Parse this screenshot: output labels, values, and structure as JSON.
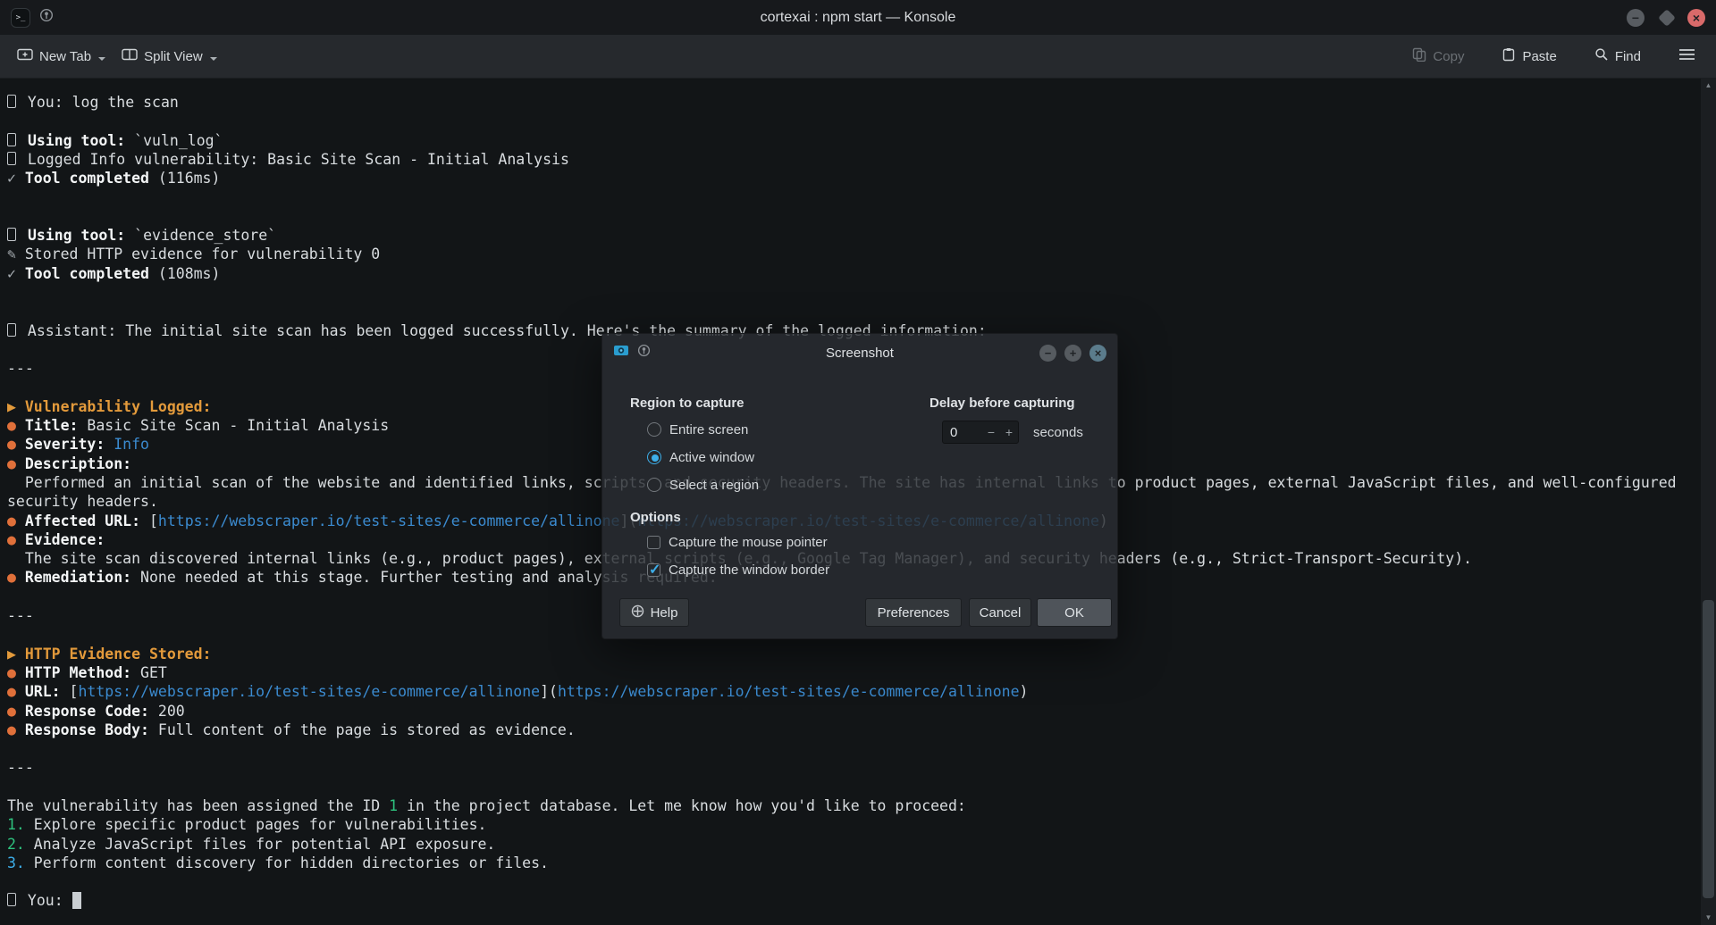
{
  "window": {
    "title": "cortexai : npm start — Konsole"
  },
  "glyphs": {
    "minimize": "−",
    "close": "×",
    "minus": "−",
    "plus": "+",
    "scroll_up": "▲",
    "scroll_down": "▼",
    "check": "✓",
    "app_icon_text": ">_"
  },
  "toolbar": {
    "new_tab_label": "New Tab",
    "split_view_label": "Split View",
    "copy_label": "Copy",
    "paste_label": "Paste",
    "find_label": "Find"
  },
  "terminal": {
    "lines": [
      [
        {
          "c": "box"
        },
        {
          "t": " You: log the scan"
        }
      ],
      [],
      [
        {
          "c": "box"
        },
        {
          "t": " "
        },
        {
          "t": "Using tool:",
          "c": "b"
        },
        {
          "t": " `vuln_log`"
        }
      ],
      [
        {
          "c": "box"
        },
        {
          "t": " Logged Info vulnerability: Basic Site Scan - Initial Analysis"
        }
      ],
      [
        {
          "t": "✓",
          "c": "dim"
        },
        {
          "t": " "
        },
        {
          "t": "Tool completed",
          "c": "b"
        },
        {
          "t": " (116ms)"
        }
      ],
      [],
      [],
      [
        {
          "c": "box"
        },
        {
          "t": " "
        },
        {
          "t": "Using tool:",
          "c": "b"
        },
        {
          "t": " `evidence_store`"
        }
      ],
      [
        {
          "t": "✎",
          "c": "dim"
        },
        {
          "t": " Stored HTTP evidence for vulnerability 0"
        }
      ],
      [
        {
          "t": "✓",
          "c": "dim"
        },
        {
          "t": " "
        },
        {
          "t": "Tool completed",
          "c": "b"
        },
        {
          "t": " (108ms)"
        }
      ],
      [],
      [],
      [
        {
          "c": "box"
        },
        {
          "t": " Assistant: The initial site scan has been logged successfully. Here's the summary of the logged information:"
        }
      ],
      [],
      [
        {
          "t": "---"
        }
      ],
      [],
      [
        {
          "t": "▶ ",
          "c": "orange"
        },
        {
          "t": "Vulnerability Logged:",
          "c": "orange b"
        }
      ],
      [
        {
          "t": "● ",
          "c": "bullet"
        },
        {
          "t": "Title:",
          "c": "b"
        },
        {
          "t": " Basic Site Scan - Initial Analysis"
        }
      ],
      [
        {
          "t": "● ",
          "c": "bullet"
        },
        {
          "t": "Severity:",
          "c": "b"
        },
        {
          "t": " "
        },
        {
          "t": "Info",
          "c": "link"
        }
      ],
      [
        {
          "t": "● ",
          "c": "bullet"
        },
        {
          "t": "Description:",
          "c": "b"
        }
      ],
      [
        {
          "t": "  Performed an initial scan of the website and identified links, scripts, and security headers. The site has internal links to product pages, external JavaScript files, and well-configured"
        }
      ],
      [
        {
          "t": "security headers."
        }
      ],
      [
        {
          "t": "● ",
          "c": "bullet"
        },
        {
          "t": "Affected URL:",
          "c": "b"
        },
        {
          "t": " ["
        },
        {
          "t": "https://webscraper.io/test-sites/e-commerce/allinone",
          "c": "link"
        },
        {
          "t": "]("
        },
        {
          "t": "https://webscraper.io/test-sites/e-commerce/allinone",
          "c": "link"
        },
        {
          "t": ")"
        }
      ],
      [
        {
          "t": "● ",
          "c": "bullet"
        },
        {
          "t": "Evidence:",
          "c": "b"
        }
      ],
      [
        {
          "t": "  The site scan discovered internal links (e.g., product pages), external scripts (e.g., Google Tag Manager), and security headers (e.g., Strict-Transport-Security)."
        }
      ],
      [
        {
          "t": "● ",
          "c": "bullet"
        },
        {
          "t": "Remediation:",
          "c": "b"
        },
        {
          "t": " None needed at this stage. Further testing and analysis required."
        }
      ],
      [],
      [
        {
          "t": "---"
        }
      ],
      [],
      [
        {
          "t": "▶ ",
          "c": "orange"
        },
        {
          "t": "HTTP Evidence Stored:",
          "c": "orange b"
        }
      ],
      [
        {
          "t": "● ",
          "c": "bullet"
        },
        {
          "t": "HTTP Method:",
          "c": "b"
        },
        {
          "t": " GET"
        }
      ],
      [
        {
          "t": "● ",
          "c": "bullet"
        },
        {
          "t": "URL:",
          "c": "b"
        },
        {
          "t": " ["
        },
        {
          "t": "https://webscraper.io/test-sites/e-commerce/allinone",
          "c": "link"
        },
        {
          "t": "]("
        },
        {
          "t": "https://webscraper.io/test-sites/e-commerce/allinone",
          "c": "link"
        },
        {
          "t": ")"
        }
      ],
      [
        {
          "t": "● ",
          "c": "bullet"
        },
        {
          "t": "Response Code:",
          "c": "b"
        },
        {
          "t": " 200"
        }
      ],
      [
        {
          "t": "● ",
          "c": "bullet"
        },
        {
          "t": "Response Body:",
          "c": "b"
        },
        {
          "t": " Full content of the page is stored as evidence."
        }
      ],
      [],
      [
        {
          "t": "---"
        }
      ],
      [],
      [
        {
          "t": "The vulnerability has been assigned the ID "
        },
        {
          "t": "1",
          "c": "green"
        },
        {
          "t": " in the project database. Let me know how you'd like to proceed:"
        }
      ],
      [
        {
          "t": "1.",
          "c": "green"
        },
        {
          "t": " Explore specific product pages for vulnerabilities."
        }
      ],
      [
        {
          "t": "2.",
          "c": "green"
        },
        {
          "t": " Analyze JavaScript files for potential API exposure."
        }
      ],
      [
        {
          "t": "3.",
          "c": "blue"
        },
        {
          "t": " Perform content discovery for hidden directories or files."
        }
      ],
      [],
      [
        {
          "c": "box"
        },
        {
          "t": " You: "
        },
        {
          "t": " ",
          "c": "cursor"
        }
      ]
    ]
  },
  "dialog": {
    "title": "Screenshot",
    "region_section": "Region to capture",
    "radios": [
      {
        "label": "Entire screen",
        "selected": false
      },
      {
        "label": "Active window",
        "selected": true
      },
      {
        "label": "Select a region",
        "selected": false
      }
    ],
    "delay_section": "Delay before capturing",
    "delay_value": "0",
    "seconds_label": "seconds",
    "options_section": "Options",
    "checkboxes": [
      {
        "label": "Capture the mouse pointer",
        "checked": false
      },
      {
        "label": "Capture the window border",
        "checked": true
      }
    ],
    "help_label": "Help",
    "preferences_label": "Preferences",
    "cancel_label": "Cancel",
    "ok_label": "OK"
  },
  "colors": {
    "accent": "#3daee9",
    "link": "#3b8bd0",
    "orange_header": "#e39a3b",
    "bullet": "#e0703a",
    "green": "#2ec27e",
    "terminal_bg": "#121517"
  }
}
